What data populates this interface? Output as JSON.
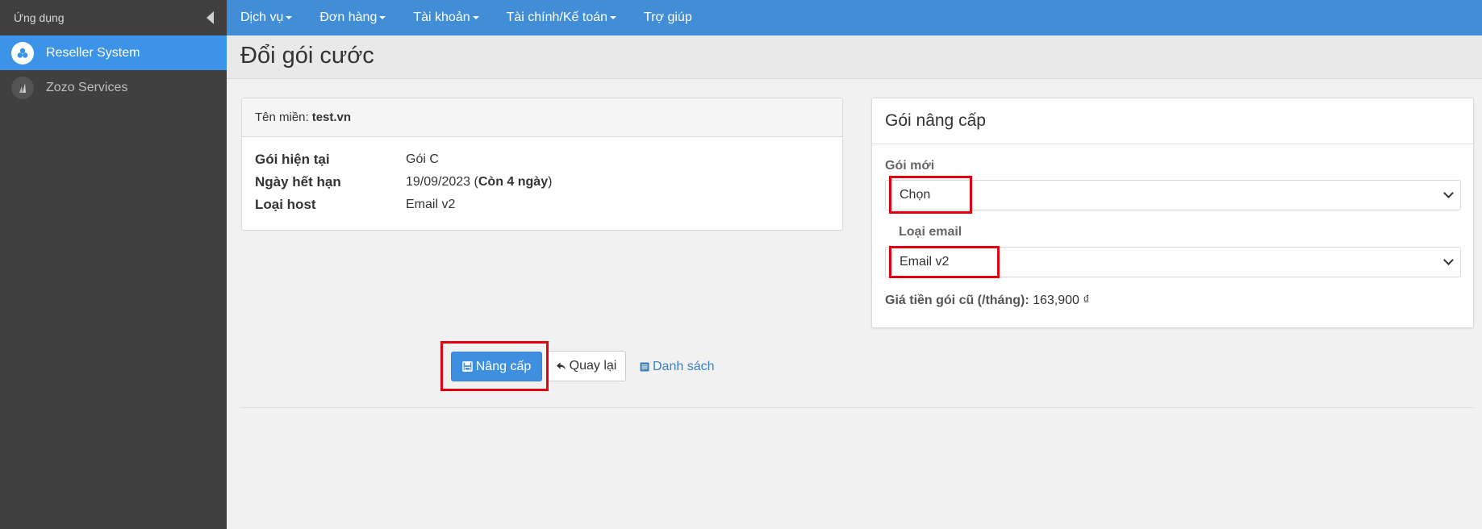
{
  "sidebar": {
    "header_label": "Ứng dụng",
    "items": [
      {
        "label": "Reseller System",
        "icon": "reseller-icon",
        "active": true
      },
      {
        "label": "Zozo Services",
        "icon": "zozo-icon",
        "active": false
      }
    ]
  },
  "topnav": {
    "items": [
      {
        "label": "Dịch vụ",
        "has_caret": true
      },
      {
        "label": "Đơn hàng",
        "has_caret": true
      },
      {
        "label": "Tài khoản",
        "has_caret": true
      },
      {
        "label": "Tài chính/Kế toán",
        "has_caret": true
      },
      {
        "label": "Trợ giúp",
        "has_caret": false
      }
    ]
  },
  "page": {
    "title": "Đổi gói cước"
  },
  "domain_panel": {
    "domain_label": "Tên miền:",
    "domain_value": "test.vn",
    "rows": [
      {
        "label": "Gói hiện tại",
        "value": "Gói C"
      },
      {
        "label": "Ngày hết hạn",
        "value_prefix": "19/09/2023 (",
        "value_bold": "Còn 4 ngày",
        "value_suffix": ")"
      },
      {
        "label": "Loại host",
        "value": "Email v2"
      }
    ]
  },
  "upgrade_panel": {
    "title": "Gói nâng cấp",
    "new_package_label": "Gói mới",
    "new_package_selected": "Chọn",
    "email_type_label": "Loại email",
    "email_type_selected": "Email v2",
    "old_price_label": "Giá tiền gói cũ (/tháng):",
    "old_price_value": "163,900 ₫"
  },
  "actions": {
    "upgrade_label": "Nâng cấp",
    "back_label": "Quay lại",
    "list_label": "Danh sách"
  },
  "colors": {
    "sidebar_bg": "#404040",
    "nav_bg": "#418ed7",
    "active_item": "#3c94e8",
    "highlight": "#e3000f"
  }
}
